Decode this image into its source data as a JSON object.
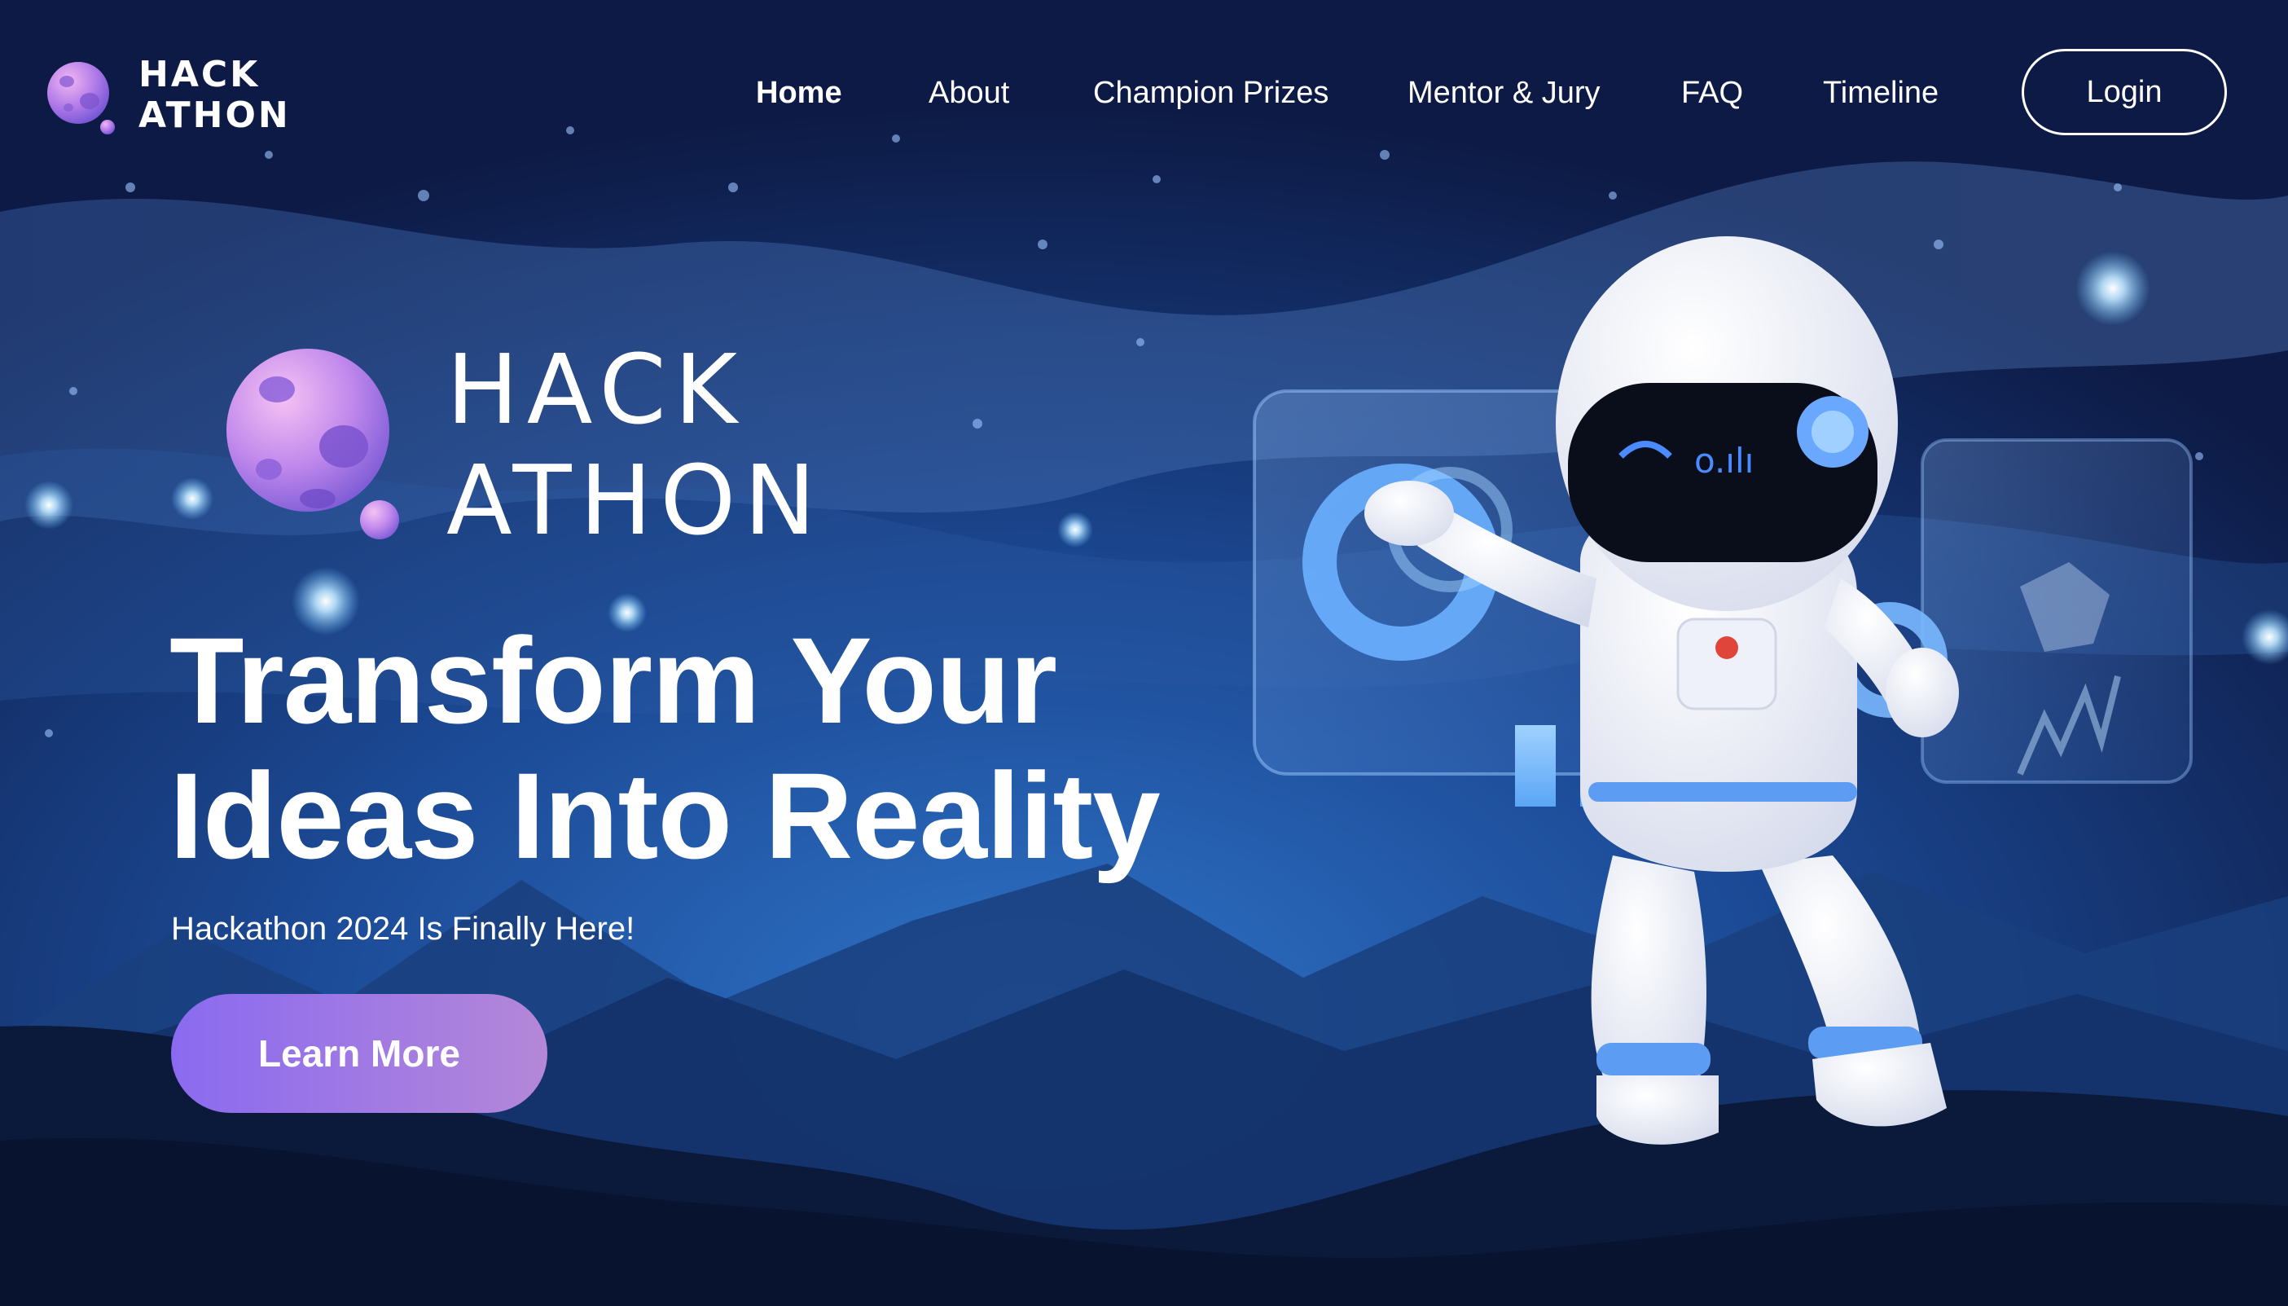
{
  "header": {
    "logo": {
      "line1": "HACK",
      "line2": "ATHON"
    },
    "nav": [
      {
        "label": "Home",
        "active": true
      },
      {
        "label": "About",
        "active": false
      },
      {
        "label": "Champion Prizes",
        "active": false
      },
      {
        "label": "Mentor & Jury",
        "active": false
      },
      {
        "label": "FAQ",
        "active": false
      },
      {
        "label": "Timeline",
        "active": false
      }
    ],
    "login_label": "Login"
  },
  "hero": {
    "brand": {
      "line1": "HACK",
      "line2": "ATHON"
    },
    "headline": {
      "line1": "Transform Your",
      "line2": "Ideas Into Reality"
    },
    "subtitle": "Hackathon 2024 Is Finally Here!",
    "cta_label": "Learn More"
  },
  "theme": {
    "background": "#0d1a45",
    "accent_gradient_start": "#8a6af0",
    "accent_gradient_end": "#b487d8",
    "planet": "#c98ff0"
  },
  "icons": {
    "logo_icon": "planet-icon",
    "hero_icon": "planet-icon",
    "illustration": "astronaut-illustration"
  }
}
